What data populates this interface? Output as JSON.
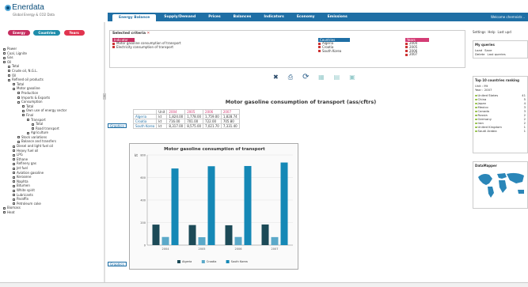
{
  "header": {
    "logo_text": "Enerdata",
    "logo_sub": "Global Energy & CO2 Data",
    "tabs": [
      "Energy Balance",
      "Supply/Demand",
      "Prices",
      "Balances",
      "Indicators",
      "Economy",
      "Emissions"
    ],
    "welcome": "Welcome chemnistr..."
  },
  "left": {
    "pills": [
      {
        "label": "Energy",
        "color": "#c62d5f"
      },
      {
        "label": "Countries",
        "color": "#1f8dab"
      },
      {
        "label": "Years",
        "color": "#e1344f"
      }
    ],
    "tree": [
      {
        "label": "Power",
        "indent": 0
      },
      {
        "label": "Coal, Lignite",
        "indent": 0
      },
      {
        "label": "Gas",
        "indent": 0
      },
      {
        "label": "Oil",
        "indent": 0
      },
      {
        "label": "Total",
        "indent": 1
      },
      {
        "label": "Crude oil, N.G.L.",
        "indent": 1
      },
      {
        "label": "Oil",
        "indent": 1
      },
      {
        "label": "Refined oil products",
        "indent": 1
      },
      {
        "label": "Total",
        "indent": 2
      },
      {
        "label": "Motor gasoline",
        "indent": 2
      },
      {
        "label": "Production",
        "indent": 3
      },
      {
        "label": "Imports & Exports",
        "indent": 3
      },
      {
        "label": "Consumption",
        "indent": 3
      },
      {
        "label": "Total",
        "indent": 4
      },
      {
        "label": "Own use of energy sector",
        "indent": 4
      },
      {
        "label": "Final",
        "indent": 4
      },
      {
        "label": "Transport",
        "indent": 5
      },
      {
        "label": "Total",
        "indent": 6
      },
      {
        "label": "Road transport",
        "indent": 6
      },
      {
        "label": "Agriculture",
        "indent": 5
      },
      {
        "label": "Stock variations",
        "indent": 3
      },
      {
        "label": "Balance and transfers",
        "indent": 3
      },
      {
        "label": "Diesel and light fuel oil",
        "indent": 2
      },
      {
        "label": "Heavy fuel oil",
        "indent": 2
      },
      {
        "label": "LPG",
        "indent": 2
      },
      {
        "label": "Ethane",
        "indent": 2
      },
      {
        "label": "Refinery gas",
        "indent": 2
      },
      {
        "label": "Jet fuel",
        "indent": 2
      },
      {
        "label": "Aviation gasoline",
        "indent": 2
      },
      {
        "label": "Kerosene",
        "indent": 2
      },
      {
        "label": "Naphta",
        "indent": 2
      },
      {
        "label": "Bitumen",
        "indent": 2
      },
      {
        "label": "White spirit",
        "indent": 2
      },
      {
        "label": "Lubricants",
        "indent": 2
      },
      {
        "label": "Paraffin",
        "indent": 2
      },
      {
        "label": "Petroleum coke",
        "indent": 2
      },
      {
        "label": "Biomass",
        "indent": 0
      },
      {
        "label": "Heat",
        "indent": 0
      }
    ]
  },
  "criteria": {
    "title": "Selected criteria",
    "energy_head": "Indicator",
    "energy_items": [
      "Motor gasoline consumption of transport",
      "Electricity consumption of transport"
    ],
    "countries_head": "Countries",
    "countries_items": [
      "Algeria",
      "Croatia",
      "South Korea"
    ],
    "years_head": "Years",
    "years_items": [
      "2004",
      "2005",
      "2006",
      "2007"
    ]
  },
  "toolbar": {
    "icons": [
      "close-icon",
      "print-icon",
      "refresh-icon",
      "export-excel-icon",
      "export-pdf-icon",
      "export-image-icon"
    ]
  },
  "main": {
    "chart_title": "Motor gasoline consumption of transport (ass/cftrs)",
    "table_header": [
      "",
      "Unit",
      "2004",
      "2005",
      "2006",
      "2007"
    ],
    "table_rows": [
      {
        "country": "Algeria",
        "unit": "kt",
        "values": [
          "1,824.00",
          "1,778.00",
          "1,759.00",
          "1,828.74"
        ]
      },
      {
        "country": "Croatia",
        "unit": "kt",
        "values": [
          "716.00",
          "701.00",
          "722.00",
          "705.80"
        ]
      },
      {
        "country": "South Korea",
        "unit": "kt",
        "values": [
          "8,317.00",
          "8,575.00",
          "7,021.70",
          "7,331.40"
        ]
      }
    ],
    "graph_button": "Graphics",
    "graph_button_2": "Graphics"
  },
  "chart_data": {
    "type": "bar",
    "title": "Motor gasoline consumption of transport",
    "categories": [
      "2004",
      "2005",
      "2006",
      "2007"
    ],
    "series": [
      {
        "name": "Algeria",
        "values": [
          182,
          178,
          176,
          183
        ]
      },
      {
        "name": "Croatia",
        "values": [
          72,
          70,
          72,
          71
        ]
      },
      {
        "name": "South Korea",
        "values": [
          680,
          700,
          702,
          733
        ]
      }
    ],
    "ylim": [
      0,
      800
    ],
    "yticks": [
      "0",
      "200",
      "400",
      "600",
      "800"
    ],
    "ylabel": "kt",
    "colors": [
      "#1c4a57",
      "#5ba9c9",
      "#1588b6"
    ],
    "legend_position": "bottom"
  },
  "right": {
    "links": [
      "Settings",
      "Help",
      "Last upd"
    ],
    "queries_title": "My queries",
    "queries_items": [
      "Load",
      "Save",
      "Delete",
      "Last queries"
    ],
    "ranking_title": "Top 10 countries ranking",
    "ranking_sub1": "Unit : Mt",
    "ranking_sub2": "Year : 2007",
    "ranking": [
      {
        "country": "United States",
        "value": "41"
      },
      {
        "country": "China",
        "value": "5"
      },
      {
        "country": "Japan",
        "value": "4"
      },
      {
        "country": "Mexico",
        "value": "3"
      },
      {
        "country": "Canada",
        "value": "3"
      },
      {
        "country": "Russia",
        "value": "2"
      },
      {
        "country": "Germany",
        "value": "2"
      },
      {
        "country": "Iran",
        "value": "2"
      },
      {
        "country": "United Kingdom",
        "value": "1"
      },
      {
        "country": "Saudi Arabia",
        "value": "1"
      }
    ],
    "datamapper_title": "DataMapper"
  }
}
